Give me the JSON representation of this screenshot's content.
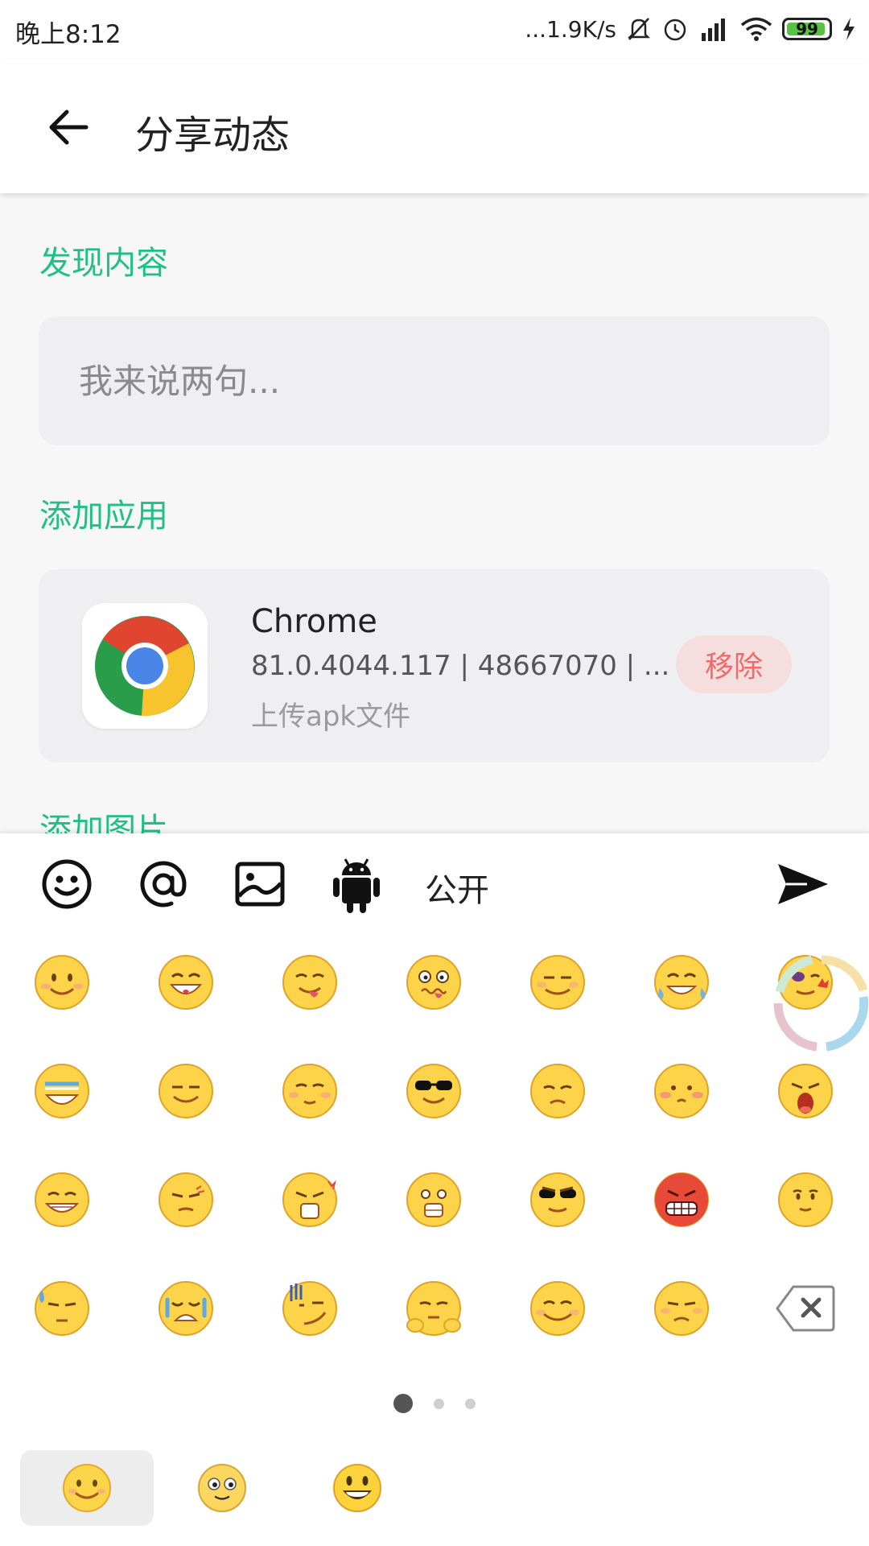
{
  "status_bar": {
    "time": "晚上8:12",
    "network_speed": "...1.9K/s",
    "battery": "99"
  },
  "toolbar": {
    "title": "分享动态"
  },
  "sections": {
    "discover_label": "发现内容",
    "add_app_label": "添加应用",
    "add_image_label": "添加图片"
  },
  "comment": {
    "placeholder": "我来说两句..."
  },
  "app_card": {
    "name": "Chrome",
    "meta": "81.0.4044.117 | 48667070 | ...",
    "upload": "上传apk文件",
    "remove_label": "移除"
  },
  "input_toolbar": {
    "icons": [
      "emoji-icon",
      "at-mention-icon",
      "image-icon",
      "android-icon"
    ],
    "visibility_label": "公开",
    "send_icon": "send-icon"
  },
  "emoji_pages": {
    "total": 3,
    "active": 1
  },
  "emoji_tabs": [
    "smile-face-tab",
    "classic-face-tab",
    "grin-face-tab"
  ],
  "colors": {
    "accent": "#1fbf86",
    "remove_text": "#ee6b6b",
    "remove_bg": "#f6dede",
    "card_bg": "#efeff2"
  }
}
